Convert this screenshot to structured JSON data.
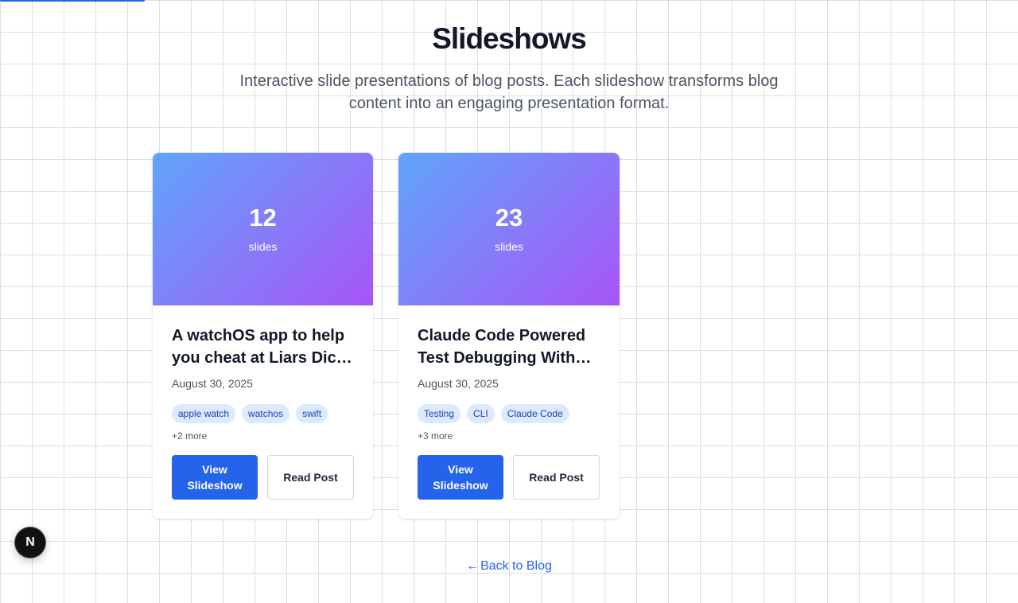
{
  "page": {
    "title": "Slideshows",
    "subtitle": "Interactive slide presentations of blog posts. Each slideshow transforms blog content into an engaging presentation format."
  },
  "cards": [
    {
      "slide_count": "12",
      "slide_unit": "slides",
      "title": "A watchOS app to help you cheat at Liars Dice (Sorta)",
      "date": "August 30, 2025",
      "tags": [
        "apple watch",
        "watchos",
        "swift"
      ],
      "more": "+2 more",
      "view_label": "View Slideshow",
      "read_label": "Read Post"
    },
    {
      "slide_count": "23",
      "slide_unit": "slides",
      "title": "Claude Code Powered Test Debugging Without the Headache",
      "date": "August 30, 2025",
      "tags": [
        "Testing",
        "CLI",
        "Claude Code"
      ],
      "more": "+3 more",
      "view_label": "View Slideshow",
      "read_label": "Read Post"
    }
  ],
  "footer": {
    "back_arrow": "←",
    "back_label": "Back to Blog"
  },
  "dev_badge": {
    "letter": "N"
  },
  "colors": {
    "accent": "#2563eb",
    "gradient_start": "#60a5fa",
    "gradient_end": "#a855f7",
    "tag_bg": "#dbeafe",
    "tag_text": "#1e40af"
  }
}
